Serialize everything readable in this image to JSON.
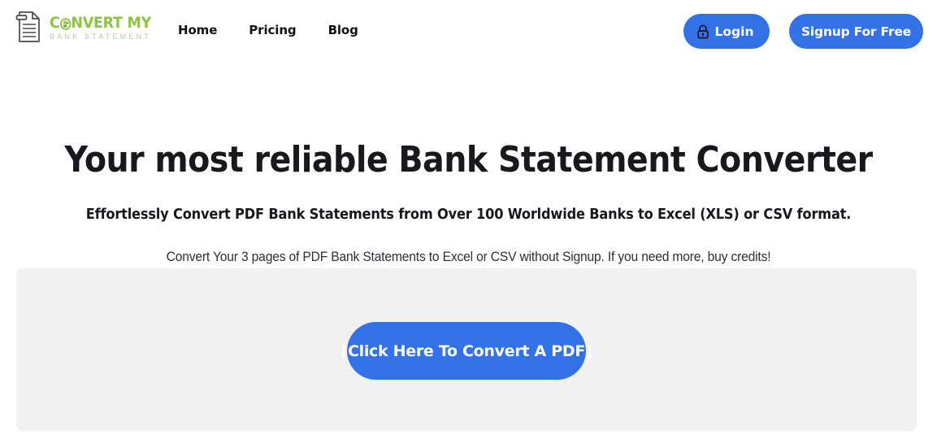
{
  "header": {
    "brand": {
      "icon": "document-icon",
      "title_before_o": "C",
      "title_after_o": "NVERT MY",
      "title_full": "CONVERT MY",
      "subtitle": "BANK STATEMENT",
      "title_color": "#8BC53F",
      "subtitle_color": "#B9CBA6",
      "o_icon": "recycle-icon"
    },
    "nav": [
      {
        "label": "Home",
        "name": "nav-link-home"
      },
      {
        "label": "Pricing",
        "name": "nav-link-pricing"
      },
      {
        "label": "Blog",
        "name": "nav-link-blog"
      }
    ],
    "login_button": {
      "label": "Login",
      "icon": "lock-icon",
      "bg_color": "#3372E6",
      "text_color": "#FFFFFF"
    },
    "signup_button": {
      "label": "Signup For Free",
      "bg_color": "#3372E6",
      "text_color": "#FFFFFF"
    }
  },
  "hero": {
    "title": "Your most reliable Bank Statement Converter",
    "subtitle": "Effortlessly Convert PDF Bank Statements from Over 100 Worldwide Banks to Excel (XLS) or CSV format.",
    "note": "Convert Your 3 pages of PDF Bank Statements to Excel or CSV without Signup. If you need more, buy credits!"
  },
  "convert_panel": {
    "bg_color": "#F1F1F1",
    "cta_label": "[Click Here To Convert A PDF]",
    "cta_bg_color": "#3372E6",
    "cta_text_color": "#FFFFFF"
  }
}
